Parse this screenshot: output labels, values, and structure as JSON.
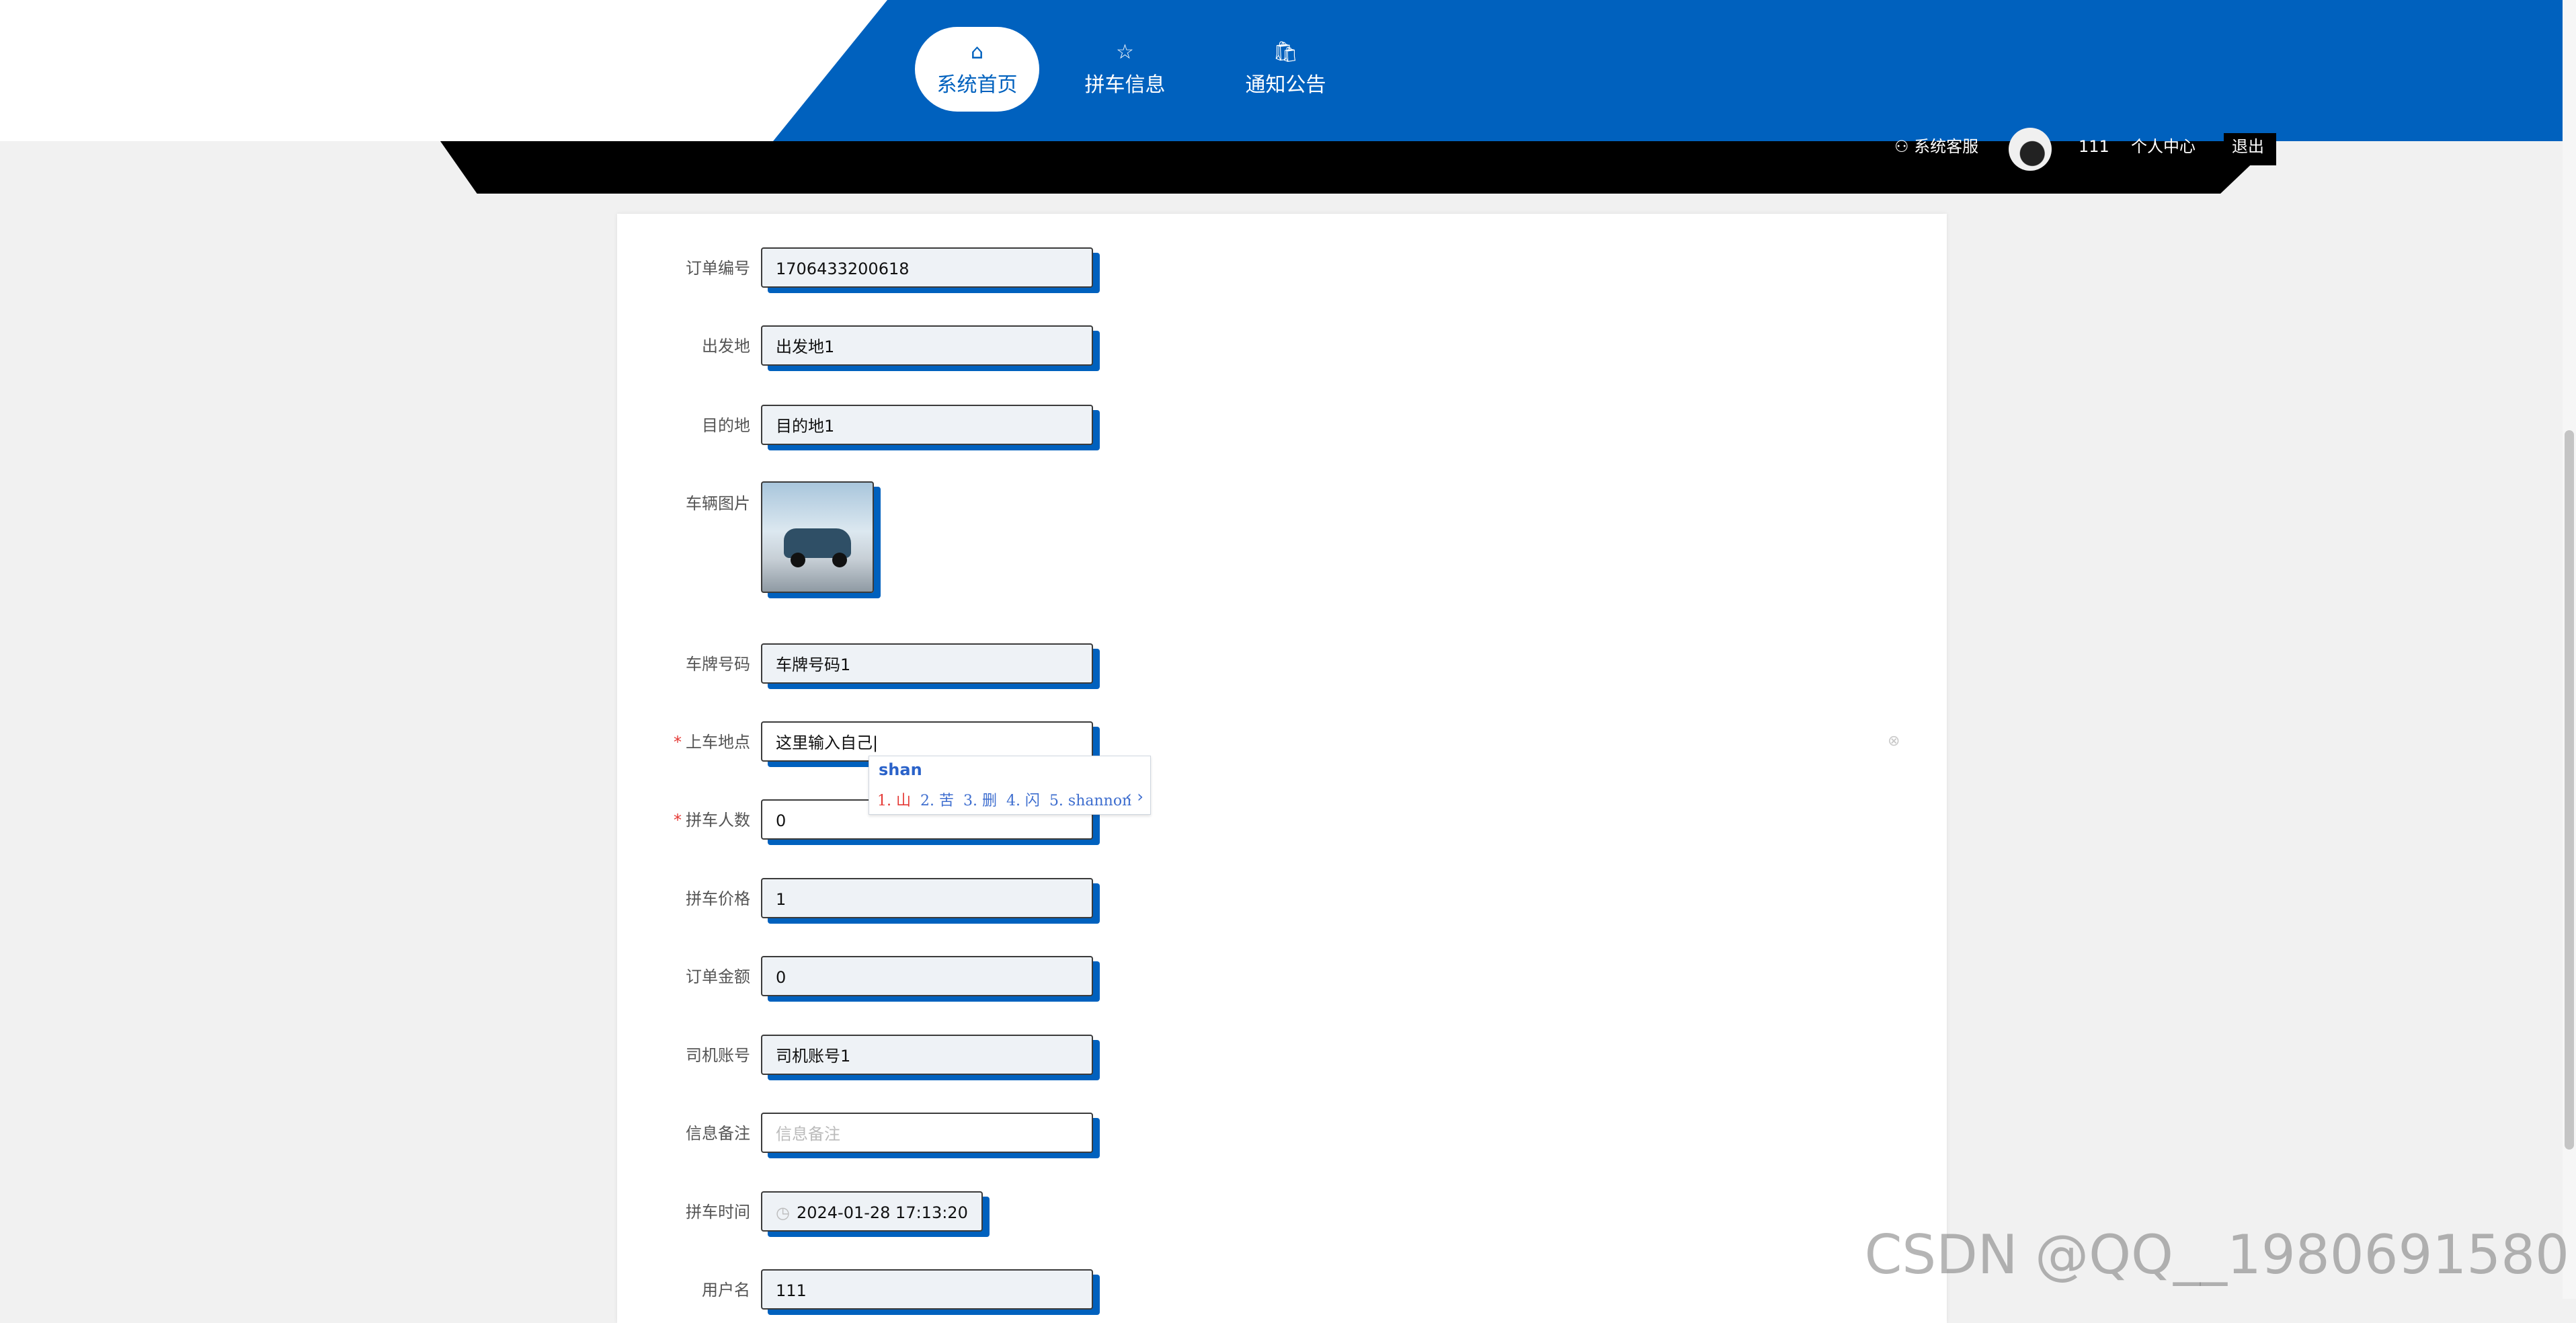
{
  "nav": {
    "items": [
      {
        "label": "系统首页",
        "icon": "home-icon",
        "glyph": "⌂",
        "active": true
      },
      {
        "label": "拼车信息",
        "icon": "star-icon",
        "glyph": "☆",
        "active": false
      },
      {
        "label": "通知公告",
        "icon": "bag-icon",
        "glyph": "🛍",
        "active": false
      }
    ]
  },
  "userbar": {
    "service_label": "系统客服",
    "username": "111",
    "profile_label": "个人中心",
    "logout_label": "退出"
  },
  "form": {
    "order_no": {
      "label": "订单编号",
      "value": "1706433200618"
    },
    "origin": {
      "label": "出发地",
      "value": "出发地1"
    },
    "destination": {
      "label": "目的地",
      "value": "目的地1"
    },
    "car_image": {
      "label": "车辆图片"
    },
    "plate": {
      "label": "车牌号码",
      "value": "车牌号码1"
    },
    "pickup": {
      "label": "上车地点",
      "value": "这里输入自己",
      "required": true
    },
    "passengers": {
      "label": "拼车人数",
      "value": "0",
      "required": true
    },
    "price": {
      "label": "拼车价格",
      "value": "1"
    },
    "amount": {
      "label": "订单金额",
      "value": "0"
    },
    "driver": {
      "label": "司机账号",
      "value": "司机账号1"
    },
    "remark": {
      "label": "信息备注",
      "placeholder": "信息备注"
    },
    "time": {
      "label": "拼车时间",
      "value": "2024-01-28 17:13:20"
    },
    "username": {
      "label": "用户名",
      "value": "111"
    }
  },
  "ime": {
    "composition": "shan",
    "candidates": [
      "1. 山",
      "2. 苦",
      "3. 删",
      "4. 闪",
      "5. shannon"
    ],
    "arrows": "‹ ›"
  },
  "watermark": "CSDN @QQ__1980691580",
  "colors": {
    "brand": "#0061be",
    "header_dark": "#000000",
    "required": "#e53935"
  }
}
